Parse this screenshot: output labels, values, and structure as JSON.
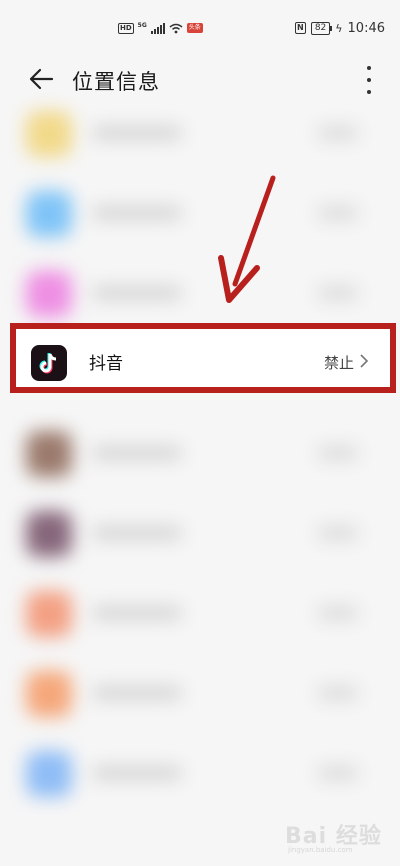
{
  "status_bar": {
    "hd": "HD",
    "network": "5G",
    "badge": "头条",
    "nfc": "N",
    "battery": "82",
    "time": "10:46"
  },
  "header": {
    "title": "位置信息"
  },
  "apps": [
    {
      "icon_color": "#f2d98a"
    },
    {
      "icon_color": "#7fc4f7"
    },
    {
      "icon_color": "#ee8fe3"
    },
    {
      "icon_color": "#9b7a6c"
    },
    {
      "icon_color": "#86667a"
    },
    {
      "icon_color": "#f3a083"
    },
    {
      "icon_color": "#f5a77a"
    },
    {
      "icon_color": "#8fbdf6"
    }
  ],
  "highlighted_app": {
    "name": "抖音",
    "status": "禁止",
    "icon": "douyin-icon"
  },
  "colors": {
    "highlight_border": "#b8201d",
    "arrow": "#b8201d"
  },
  "watermark": {
    "text": "Bai 经验",
    "subtext": "jingyan.baidu.com"
  }
}
